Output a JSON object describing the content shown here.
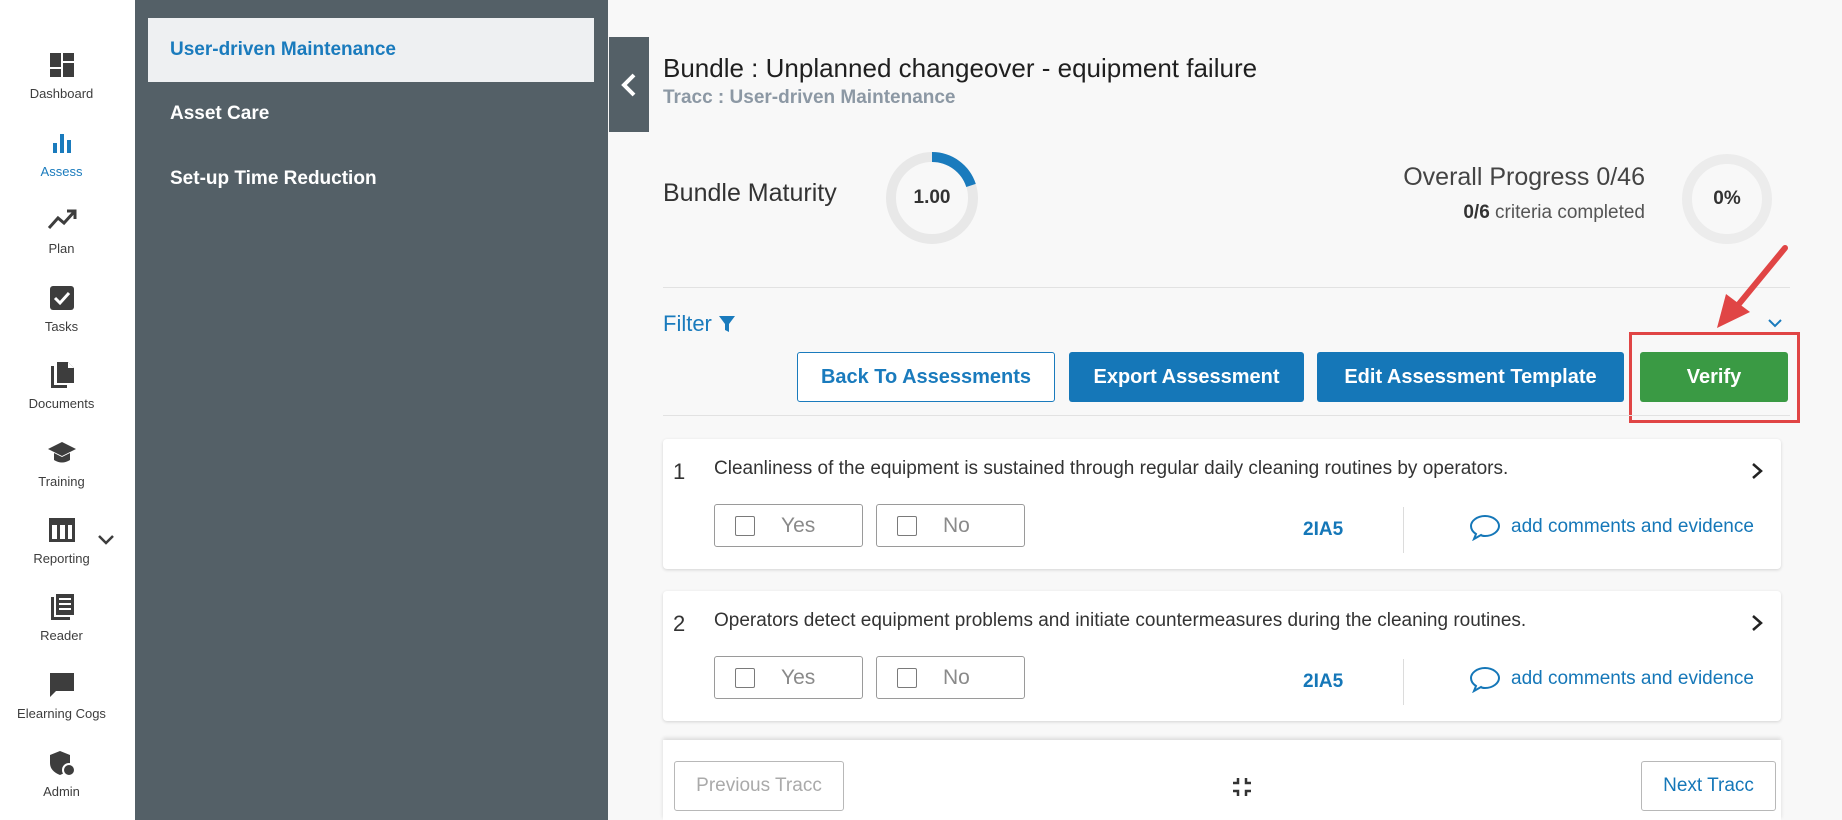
{
  "nav": {
    "items": [
      {
        "label": "Dashboard",
        "icon": "dashboard-icon"
      },
      {
        "label": "Assess",
        "icon": "bar-chart-icon",
        "active": true
      },
      {
        "label": "Plan",
        "icon": "trend-icon"
      },
      {
        "label": "Tasks",
        "icon": "checkbox-icon"
      },
      {
        "label": "Documents",
        "icon": "documents-icon"
      },
      {
        "label": "Training",
        "icon": "graduation-cap-icon"
      },
      {
        "label": "Reporting",
        "icon": "table-icon"
      },
      {
        "label": "Reader",
        "icon": "reader-icon"
      },
      {
        "label": "Elearning Cogs",
        "icon": "chat-icon"
      },
      {
        "label": "Admin",
        "icon": "admin-shield-icon"
      }
    ]
  },
  "sidebar": {
    "items": [
      {
        "label": "User-driven Maintenance",
        "active": true
      },
      {
        "label": "Asset Care"
      },
      {
        "label": "Set-up Time Reduction"
      }
    ]
  },
  "header": {
    "title": "Bundle : Unplanned changeover - equipment failure",
    "subtitle": "Tracc : User-driven Maintenance"
  },
  "maturity": {
    "label": "Bundle Maturity",
    "value": "1.00",
    "fraction": 0.2
  },
  "progress": {
    "title": "Overall Progress 0/46",
    "criteria_count": "0/6",
    "criteria_text": " criteria completed",
    "percent_label": "0%",
    "fraction": 0
  },
  "filter": {
    "label": "Filter"
  },
  "actions": {
    "back": "Back To Assessments",
    "export": "Export Assessment",
    "edit": "Edit Assessment Template",
    "verify": "Verify"
  },
  "questions": [
    {
      "num": "1",
      "text": "Cleanliness of the equipment is sustained through regular daily cleaning routines by operators.",
      "yes": "Yes",
      "no": "No",
      "code": "2IA5",
      "comment": "add comments and evidence"
    },
    {
      "num": "2",
      "text": "Operators detect equipment problems and initiate countermeasures during the cleaning routines.",
      "yes": "Yes",
      "no": "No",
      "code": "2IA5",
      "comment": "add comments and evidence"
    }
  ],
  "footer": {
    "prev": "Previous Tracc",
    "next": "Next Tracc"
  },
  "colors": {
    "accent": "#1577b8",
    "sidebar": "#546067",
    "verify": "#3a9a44",
    "highlight": "#e04545"
  }
}
